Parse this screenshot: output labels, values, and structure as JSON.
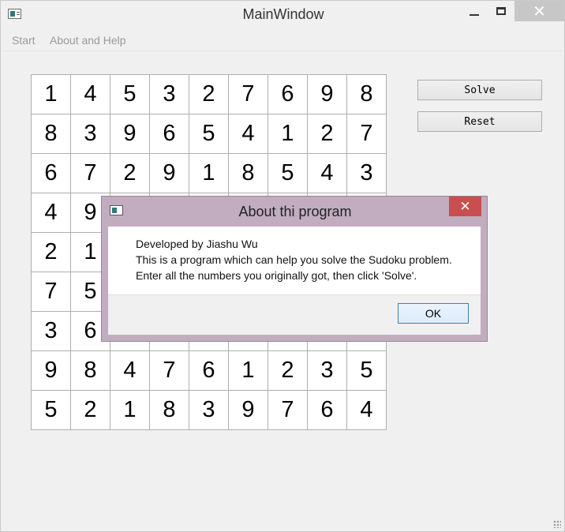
{
  "window": {
    "title": "MainWindow",
    "close_glyph": "✕"
  },
  "menu": {
    "items": [
      "Start",
      "About and Help"
    ]
  },
  "sudoku": {
    "rows": [
      [
        "1",
        "4",
        "5",
        "3",
        "2",
        "7",
        "6",
        "9",
        "8"
      ],
      [
        "8",
        "3",
        "9",
        "6",
        "5",
        "4",
        "1",
        "2",
        "7"
      ],
      [
        "6",
        "7",
        "2",
        "9",
        "1",
        "8",
        "5",
        "4",
        "3"
      ],
      [
        "4",
        "9",
        "",
        "",
        "",
        "",
        "",
        "",
        ""
      ],
      [
        "2",
        "1",
        "",
        "",
        "",
        "",
        "",
        "",
        ""
      ],
      [
        "7",
        "5",
        "",
        "",
        "",
        "",
        "",
        "",
        ""
      ],
      [
        "3",
        "6",
        "",
        "",
        "",
        "",
        "",
        "",
        ""
      ],
      [
        "9",
        "8",
        "4",
        "7",
        "6",
        "1",
        "2",
        "3",
        "5"
      ],
      [
        "5",
        "2",
        "1",
        "8",
        "3",
        "9",
        "7",
        "6",
        "4"
      ]
    ]
  },
  "buttons": {
    "solve": "Solve",
    "reset": "Reset"
  },
  "dialog": {
    "title": "About thi program",
    "close_glyph": "✕",
    "lines": [
      "Developed by Jiashu Wu",
      "This is a program which can help you solve the Sudoku problem.",
      "Enter all the numbers you originally got, then click 'Solve'."
    ],
    "ok": "OK"
  }
}
